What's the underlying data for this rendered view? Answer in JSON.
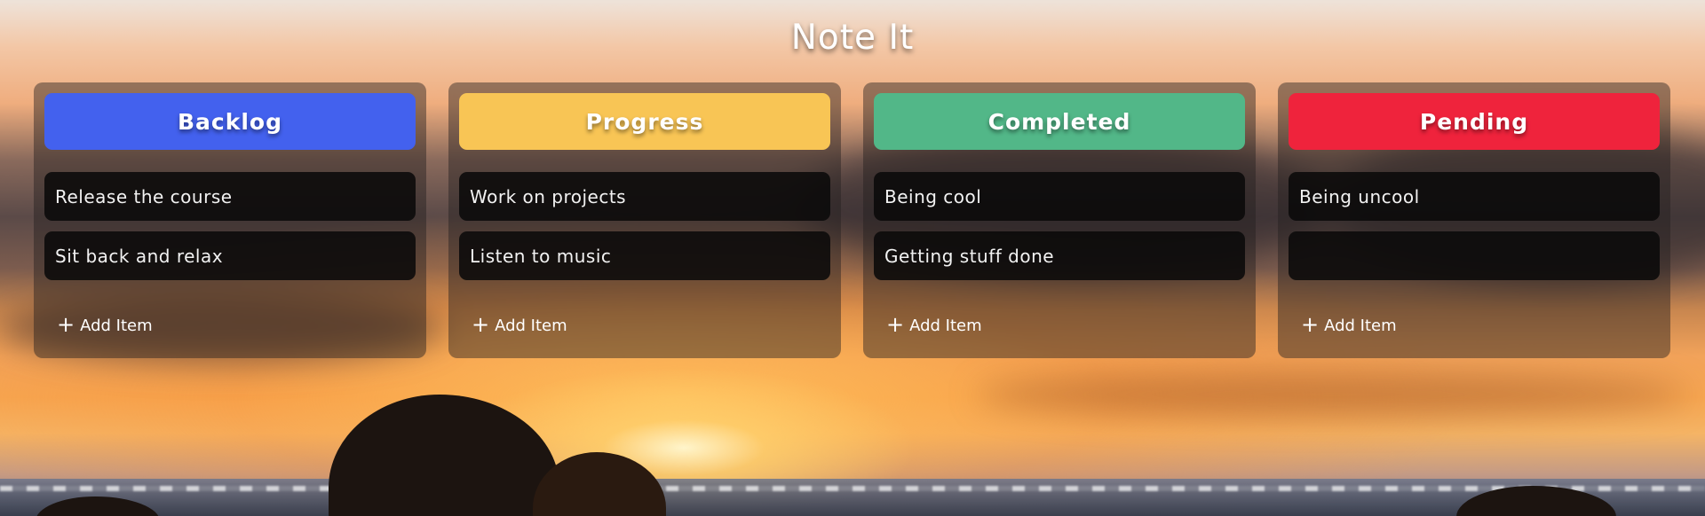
{
  "app": {
    "title": "Note It"
  },
  "columns": [
    {
      "title": "Backlog",
      "color": "#4361ee",
      "items": [
        "Release the course",
        "Sit back and relax"
      ],
      "add_label": "Add Item"
    },
    {
      "title": "Progress",
      "color": "#f8c555",
      "items": [
        "Work on projects",
        "Listen to music"
      ],
      "add_label": "Add Item"
    },
    {
      "title": "Completed",
      "color": "#52b788",
      "items": [
        "Being cool",
        "Getting stuff done"
      ],
      "add_label": "Add Item"
    },
    {
      "title": "Pending",
      "color": "#ef233c",
      "items": [
        "Being uncool",
        ""
      ],
      "add_label": "Add Item"
    }
  ],
  "icons": {
    "add": "plus-icon"
  }
}
